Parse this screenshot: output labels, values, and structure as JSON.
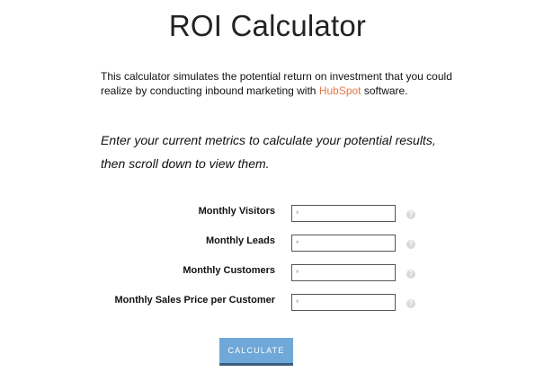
{
  "page": {
    "title": "ROI Calculator"
  },
  "intro": {
    "text_before_link": "This calculator simulates the potential return on investment that you could realize by conducting inbound marketing with ",
    "link_text": "HubSpot",
    "text_after_link": " software."
  },
  "instructions": {
    "text": "Enter your current metrics to calculate your potential results, then scroll down to view them."
  },
  "form": {
    "fields": [
      {
        "label": "Monthly Visitors",
        "value": "",
        "placeholder": "*",
        "help_icon": "question-icon"
      },
      {
        "label": "Monthly Leads",
        "value": "",
        "placeholder": "*",
        "help_icon": "question-icon"
      },
      {
        "label": "Monthly Customers",
        "value": "",
        "placeholder": "*",
        "help_icon": "question-icon"
      },
      {
        "label": "Monthly Sales Price per Customer",
        "value": "",
        "placeholder": "*",
        "help_icon": "question-icon"
      }
    ],
    "submit_label": "CALCULATE"
  },
  "colors": {
    "link": "#e8764a",
    "button_bg": "#6fa8d9",
    "button_border": "#3c5e80",
    "help_icon": "#d9d9d9"
  }
}
